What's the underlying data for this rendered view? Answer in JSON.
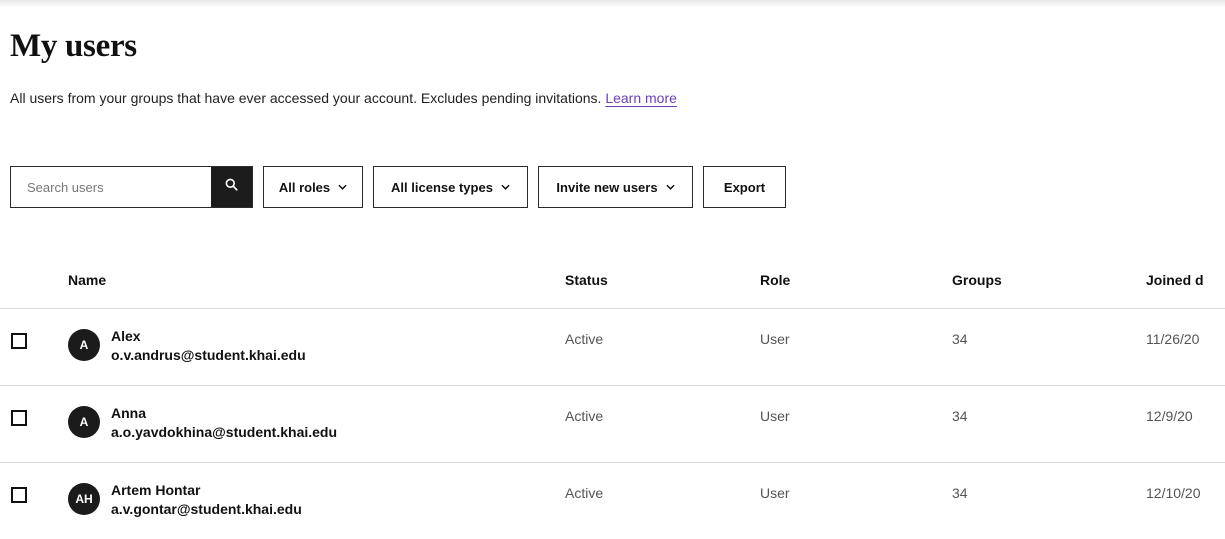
{
  "page": {
    "title": "My users",
    "subtitle": "All users from your groups that have ever accessed your account. Excludes pending invitations.",
    "learn_more": "Learn more"
  },
  "toolbar": {
    "search_placeholder": "Search users",
    "search_icon": "search-icon",
    "roles_label": "All roles",
    "license_label": "All license types",
    "invite_label": "Invite new users",
    "export_label": "Export"
  },
  "table": {
    "columns": {
      "name": "Name",
      "status": "Status",
      "role": "Role",
      "groups": "Groups",
      "joined": "Joined d"
    },
    "rows": [
      {
        "initials": "A",
        "name": "Alex",
        "email": "o.v.andrus@student.khai.edu",
        "status": "Active",
        "role": "User",
        "groups": "34",
        "joined": "11/26/20"
      },
      {
        "initials": "A",
        "name": "Anna",
        "email": "a.o.yavdokhina@student.khai.edu",
        "status": "Active",
        "role": "User",
        "groups": "34",
        "joined": "12/9/20"
      },
      {
        "initials": "AH",
        "name": "Artem Hontar",
        "email": "a.v.gontar@student.khai.edu",
        "status": "Active",
        "role": "User",
        "groups": "34",
        "joined": "12/10/20"
      }
    ]
  },
  "colors": {
    "accent_link": "#6b3fb8",
    "dark": "#1c1c1c",
    "divider": "#dcdcdc"
  }
}
